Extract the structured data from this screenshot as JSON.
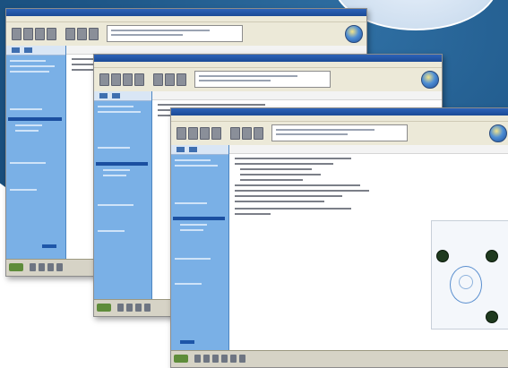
{
  "windows": [
    {
      "id": "window-back"
    },
    {
      "id": "window-middle"
    },
    {
      "id": "window-front"
    }
  ],
  "colors": {
    "backdrop": "#1d5586",
    "sidebar": "#7ab0e6",
    "sidebar_selected": "#1b4fa0",
    "titlebar": "#2c62b8",
    "toolbar": "#ece9d8",
    "diagram_node": "#1f3a1f"
  },
  "icons": [
    "globe-icon",
    "toolbar-icon",
    "start-icon",
    "taskbar-icon"
  ]
}
